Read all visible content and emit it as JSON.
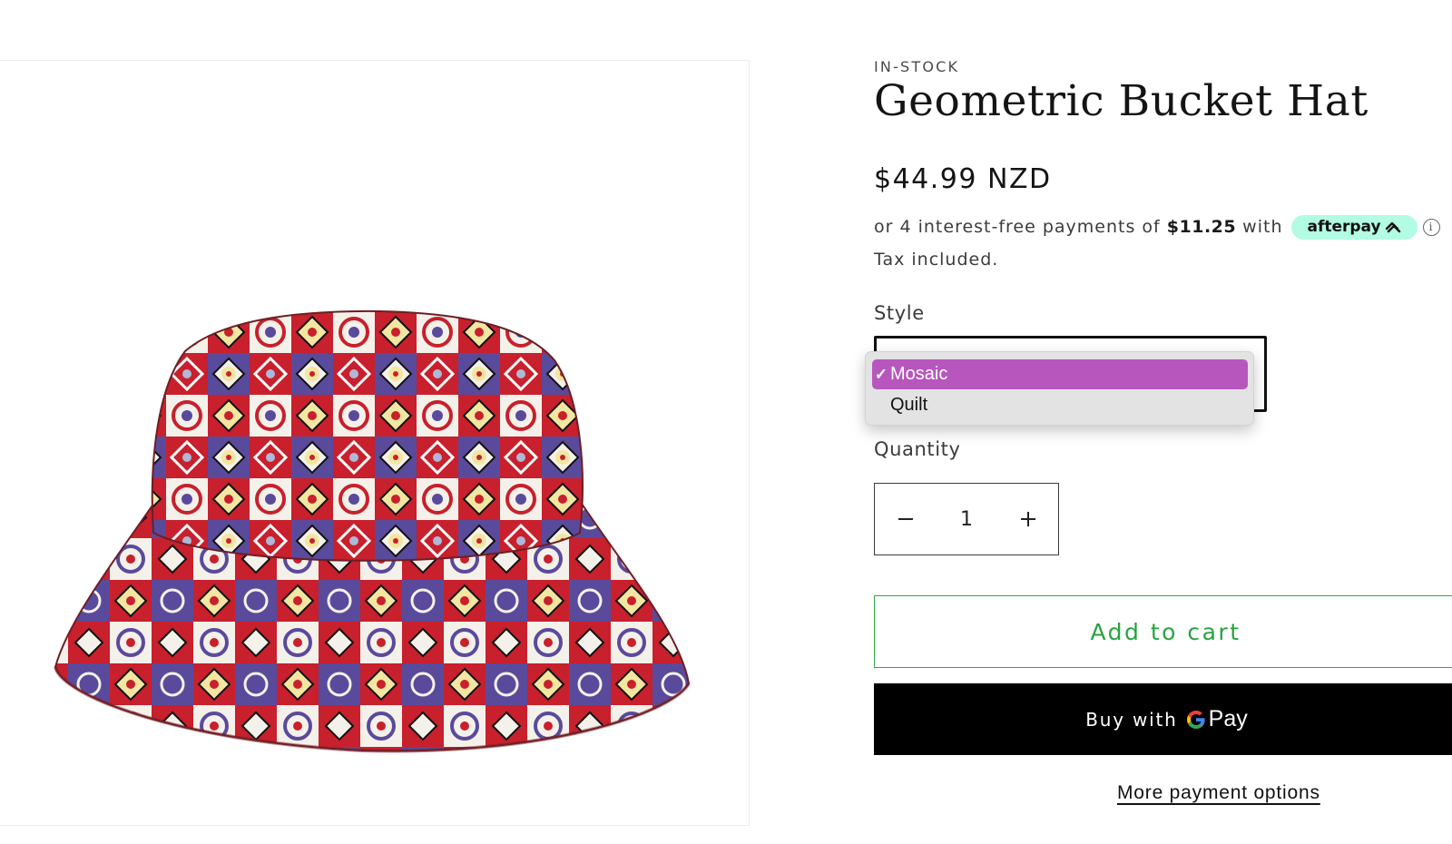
{
  "product": {
    "stock_status": "IN-STOCK",
    "title": "Geometric Bucket Hat",
    "price": "$44.99 NZD",
    "afterpay": {
      "prefix": "or 4 interest-free payments of",
      "amount": "$11.25",
      "suffix": "with",
      "badge_label": "afterpay",
      "info_icon": "info-icon",
      "badge_color": "#b2fce4"
    },
    "tax_note": "Tax included."
  },
  "style_select": {
    "label": "Style",
    "options": [
      {
        "label": "Mosaic",
        "selected": true
      },
      {
        "label": "Quilt",
        "selected": false
      }
    ],
    "highlight_color": "#b757be"
  },
  "quantity": {
    "label": "Quantity",
    "value": "1",
    "decrement_icon": "minus-icon",
    "increment_icon": "plus-icon"
  },
  "buttons": {
    "add_to_cart": "Add to cart",
    "add_to_cart_color": "#27a340",
    "buy_with_prefix": "Buy with",
    "gpay_label": "Pay",
    "more_payment": "More payment options"
  },
  "media": {
    "image_alt": "Geometric mosaic-print bucket hat",
    "pattern_colors": [
      "#c8202c",
      "#5a4a9c",
      "#f3e6a0",
      "#ffffff",
      "#aeb8d9"
    ]
  }
}
